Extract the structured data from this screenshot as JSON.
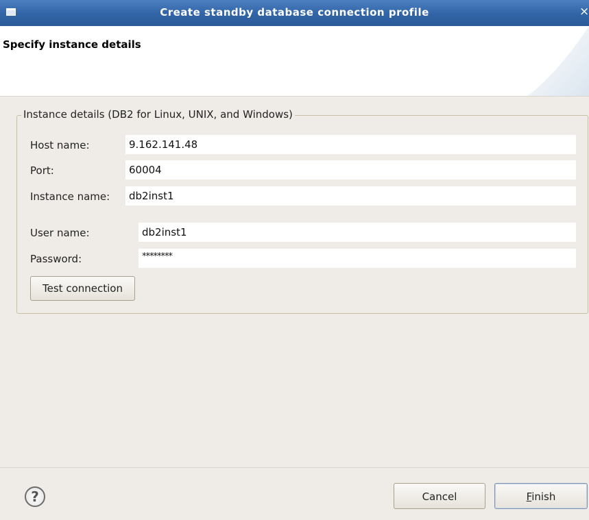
{
  "window": {
    "title": "Create standby database connection profile",
    "close_glyph": "×"
  },
  "header": {
    "heading": "Specify instance details"
  },
  "group": {
    "legend": "Instance details (DB2 for Linux, UNIX, and Windows)"
  },
  "fields": {
    "host_label": "Host name:",
    "host_value": "9.162.141.48",
    "port_label": "Port:",
    "port_value": "60004",
    "instance_label": "Instance name:",
    "instance_value": "db2inst1",
    "user_label": "User name:",
    "user_value": "db2inst1",
    "password_label": "Password:",
    "password_value": "********"
  },
  "buttons": {
    "test_connection": "Test connection",
    "cancel": "Cancel",
    "finish_mnemonic": "F",
    "finish_rest": "inish",
    "help_glyph": "?"
  },
  "icons": {
    "window": "window-menu-icon",
    "close": "close-icon",
    "help": "help-icon"
  },
  "colors": {
    "titlebar": "#3164a6",
    "background": "#efebe7",
    "group_border": "#c9bfa6",
    "finish_border": "#7d94b5"
  }
}
